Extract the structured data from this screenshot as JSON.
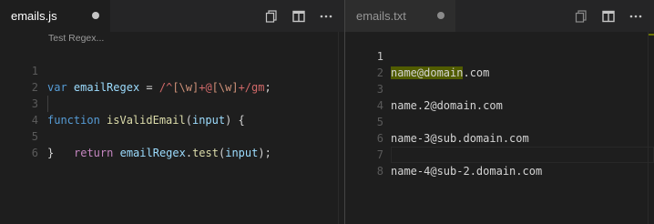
{
  "left_group": {
    "tab": {
      "label": "emails.js",
      "dirty_color": "#c5c5c5"
    },
    "codelens": "Test Regex...",
    "lines": [
      {
        "num": "1"
      },
      {
        "num": "2"
      },
      {
        "num": "3"
      },
      {
        "num": "4"
      },
      {
        "num": "5"
      },
      {
        "num": "6"
      }
    ],
    "code": {
      "l1_kw": "var",
      "l1_var": "emailRegex",
      "l1_eq": " = ",
      "l1_rx_a": "/^",
      "l1_rx_b": "[\\w]",
      "l1_rx_c": "+@",
      "l1_rx_d": "[\\w]",
      "l1_rx_e": "+/gm",
      "l1_end": ";",
      "l3_kw": "function",
      "l3_fn": "isValidEmail",
      "l3_open": "(",
      "l3_param": "input",
      "l3_close": ") {",
      "l4_kw": "return",
      "l4_var": "emailRegex",
      "l4_dot": ".",
      "l4_fn": "test",
      "l4_open": "(",
      "l4_param": "input",
      "l4_close": ");",
      "l5": "}"
    }
  },
  "right_group": {
    "tab": {
      "label": "emails.txt",
      "dirty_color": "#8a8a8a"
    },
    "lines": [
      {
        "num": "1",
        "text_match": "name@domain",
        "text_rest": ".com"
      },
      {
        "num": "2",
        "text": ""
      },
      {
        "num": "3",
        "text": "name.2@domain.com"
      },
      {
        "num": "4",
        "text": ""
      },
      {
        "num": "5",
        "text": "name-3@sub.domain.com"
      },
      {
        "num": "6",
        "text": ""
      },
      {
        "num": "7",
        "text": "name-4@sub-2.domain.com"
      },
      {
        "num": "8",
        "text": ""
      }
    ]
  },
  "icons": {
    "open_changes": "open-changes-icon",
    "split_editor": "split-editor-icon",
    "more_actions": "more-actions-icon"
  },
  "colors": {
    "editor_bg": "#1e1e1e",
    "tabbar_bg": "#252526",
    "match_highlight": "#515c00"
  }
}
